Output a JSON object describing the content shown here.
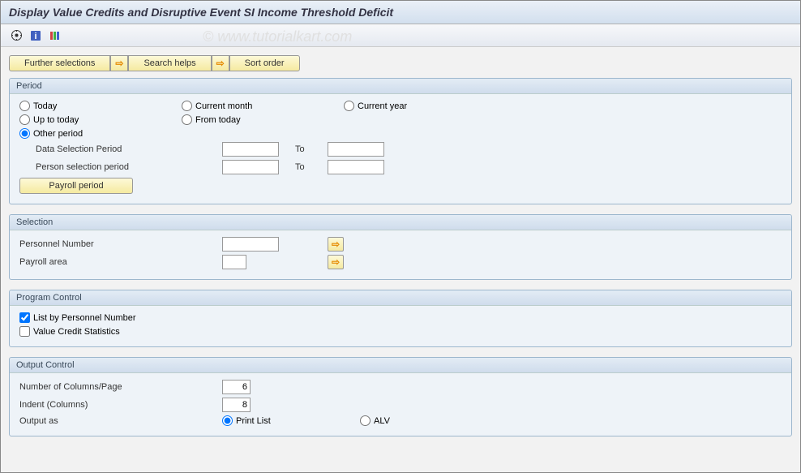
{
  "title": "Display Value Credits and Disruptive Event SI Income Threshold Deficit",
  "watermark": "© www.tutorialkart.com",
  "buttons": {
    "further": "Further selections",
    "search": "Search helps",
    "sort": "Sort order",
    "payroll": "Payroll period"
  },
  "period": {
    "header": "Period",
    "today": "Today",
    "current_month": "Current month",
    "current_year": "Current year",
    "upto": "Up to today",
    "from": "From today",
    "other": "Other period",
    "data_sel": "Data Selection Period",
    "person_sel": "Person selection period",
    "to": "To",
    "data_from": "",
    "data_to": "",
    "person_from": "",
    "person_to": ""
  },
  "selection": {
    "header": "Selection",
    "pernr": "Personnel Number",
    "area": "Payroll area",
    "pernr_val": "",
    "area_val": ""
  },
  "progctrl": {
    "header": "Program Control",
    "listby": "List by Personnel Number",
    "vstat": "Value Credit Statistics"
  },
  "output": {
    "header": "Output Control",
    "numcols": "Number of Columns/Page",
    "indent": "Indent (Columns)",
    "outputas": "Output as",
    "print": "Print List",
    "alv": "ALV",
    "numcols_val": "6",
    "indent_val": "8"
  }
}
